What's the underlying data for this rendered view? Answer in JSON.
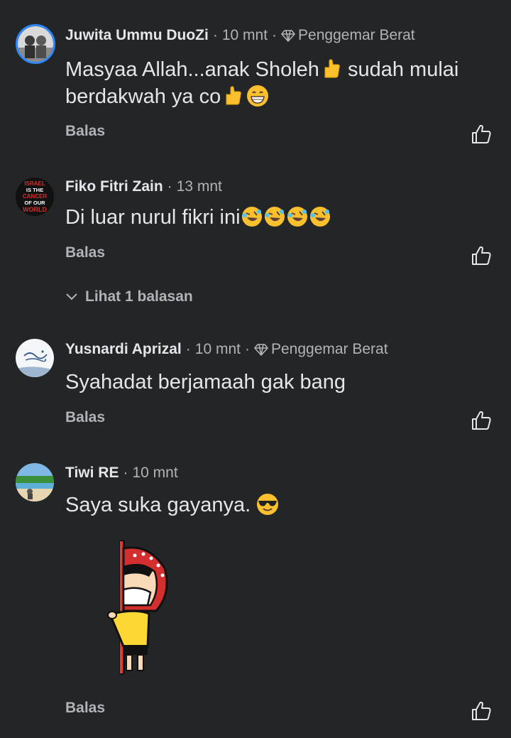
{
  "comments": [
    {
      "author": "Juwita Ummu DuoZi",
      "time": "10 mnt",
      "badge": "Penggemar Berat",
      "text_line1": "Masyaa Allah...anak Sholeh",
      "text_line1_after": " sudah mulai",
      "text_line2": "berdakwah ya co",
      "reply_label": "Balas"
    },
    {
      "author": "Fiko Fitri Zain",
      "time": "13 mnt",
      "text": "Di luar nurul fikri ini",
      "reply_label": "Balas",
      "view_replies_label": "Lihat 1 balasan",
      "avatar_text": [
        "ISRAEL",
        "IS THE",
        "CANCER",
        "OF OUR",
        "WORLD"
      ]
    },
    {
      "author": "Yusnardi Aprizal",
      "time": "10 mnt",
      "badge": "Penggemar Berat",
      "text": "Syahadat berjamaah gak bang",
      "reply_label": "Balas"
    },
    {
      "author": "Tiwi RE",
      "time": "10 mnt",
      "text": "Saya suka gayanya.",
      "reply_label": "Balas"
    }
  ],
  "icons": {
    "like": "thumbs-up-outline-icon",
    "badge": "diamond-icon",
    "chevron": "chevron-down-icon"
  },
  "colors": {
    "background": "#242527",
    "primary_text": "#e4e6eb",
    "secondary_text": "#b0b3b8",
    "avatar_ring": "#2d88ff"
  }
}
